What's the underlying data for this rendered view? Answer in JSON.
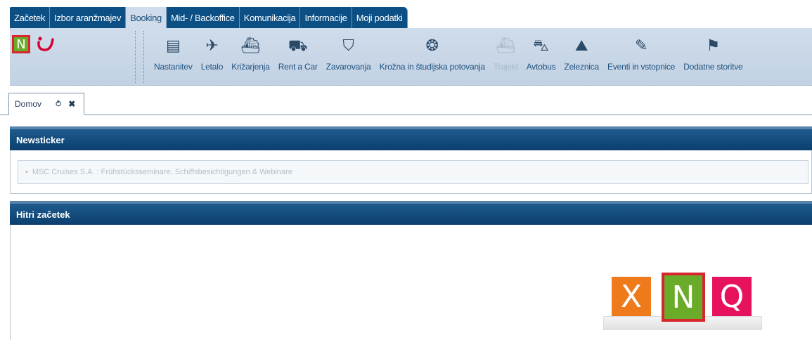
{
  "menu": {
    "tabs": [
      {
        "label": "Začetek"
      },
      {
        "label": "Izbor aranžmajev"
      },
      {
        "label": "Booking"
      },
      {
        "label": "Mid- / Backoffice"
      },
      {
        "label": "Komunikacija"
      },
      {
        "label": "Informacije"
      },
      {
        "label": "Moji podatki"
      }
    ],
    "active": "Booking"
  },
  "brand": {
    "logo_letter": "N",
    "tui_glyph": "ت"
  },
  "toolbar": {
    "items": [
      {
        "label": "Nastanitev",
        "icon": "hotel-icon",
        "glyph": "▤"
      },
      {
        "label": "Letalo",
        "icon": "airplane-icon",
        "glyph": "✈"
      },
      {
        "label": "Križarjenja",
        "icon": "cruise-icon",
        "glyph": "⛴"
      },
      {
        "label": "Rent a Car",
        "icon": "car-icon",
        "glyph": "⛟"
      },
      {
        "label": "Zavarovanja",
        "icon": "insurance-icon",
        "glyph": "⛉"
      },
      {
        "label": "Krožna in študijska potovanja",
        "icon": "backpack-icon",
        "glyph": "❂"
      },
      {
        "label": "Trajekt",
        "icon": "ferry-icon",
        "glyph": "⛴",
        "disabled": true
      },
      {
        "label": "Avtobus",
        "icon": "bus-icon",
        "glyph": "⛍"
      },
      {
        "label": "Zeleznica",
        "icon": "train-icon",
        "glyph": "⛰"
      },
      {
        "label": "Eventi in vstopnice",
        "icon": "ticket-icon",
        "glyph": "✎"
      },
      {
        "label": "Dodatne storitve",
        "icon": "services-icon",
        "glyph": "⚑"
      }
    ]
  },
  "page_tab": {
    "label": "Domov",
    "refresh_glyph": "⥁",
    "close_glyph": "✖"
  },
  "newsticker": {
    "title": "Newsticker",
    "items": [
      "MSC Cruises S.A. : Frühstücksseminare, Schiffsbesichtigungen & Webinare"
    ]
  },
  "quickstart": {
    "title": "Hitri začetek",
    "logos": [
      {
        "letter": "X",
        "name": "x-logo"
      },
      {
        "letter": "N",
        "name": "n-logo"
      },
      {
        "letter": "Q",
        "name": "q-logo"
      }
    ]
  },
  "colors": {
    "menu_tab": "#0b4f84",
    "panel_header": "#0b3f6e",
    "brand_green": "#6bab2a",
    "brand_red": "#d7262e",
    "logo_orange": "#ee7a1c",
    "logo_pink": "#e6125d"
  }
}
